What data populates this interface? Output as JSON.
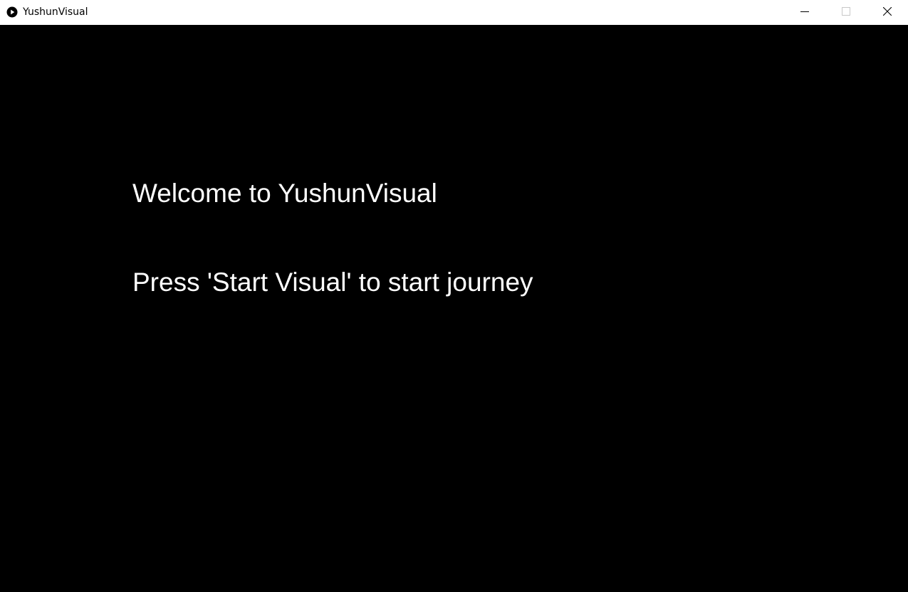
{
  "window": {
    "title": "YushunVisual",
    "app_icon": "play-circle-icon",
    "controls": {
      "minimize_icon": "minimize-icon",
      "maximize_icon": "maximize-icon",
      "close_icon": "close-icon"
    },
    "titlebar_color": "#ffffff"
  },
  "canvas": {
    "background_color": "#000000",
    "text_color": "#ffffff",
    "welcome_text": "Welcome to YushunVisual",
    "instruction_text": "Press 'Start Visual' to start journey"
  }
}
